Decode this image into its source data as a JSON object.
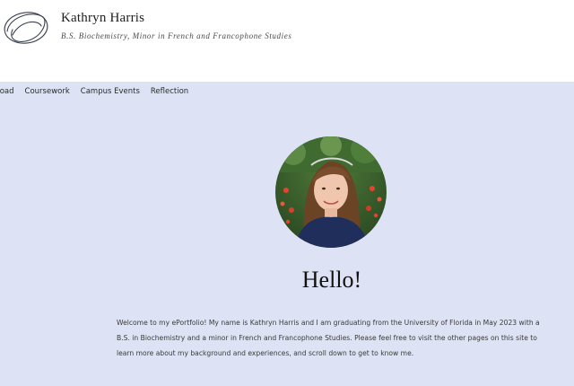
{
  "site": {
    "title": "Kathryn Harris",
    "tagline": "B.S. Biochemistry, Minor in French and Francophone Studies"
  },
  "nav": {
    "items": [
      {
        "label": "broad"
      },
      {
        "label": "Coursework"
      },
      {
        "label": "Campus Events"
      },
      {
        "label": "Reflection"
      }
    ]
  },
  "hero": {
    "heading": "Hello!",
    "intro": "Welcome to my ePortfolio! My name is Kathryn Harris and I am graduating from the University of Florida in May 2023 with a B.S. in Biochemistry and a minor in French and Francophone Studies. Please feel free to visit the other pages on this site to learn more about my background and experiences, and scroll down to get to know me."
  },
  "colors": {
    "content_background": "#dde3f4",
    "header_background": "#ffffff",
    "text": "#3a3a3a"
  }
}
